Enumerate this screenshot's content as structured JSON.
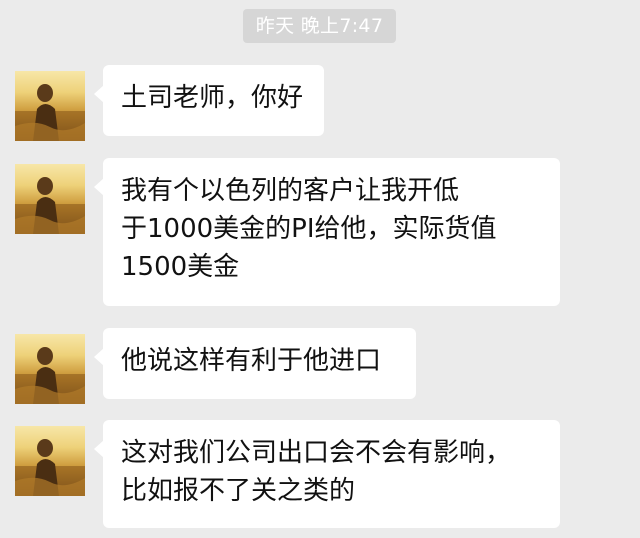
{
  "conversation": {
    "timestamp": "昨天 晚上7:47",
    "messages": [
      {
        "sender_avatar_icon": "contact-avatar-photo",
        "text": "土司老师，你好"
      },
      {
        "sender_avatar_icon": "contact-avatar-photo",
        "text": "我有个以色列的客户让我开低\n于1000美金的PI给他，实际货值\n1500美金"
      },
      {
        "sender_avatar_icon": "contact-avatar-photo",
        "text": "他说这样有利于他进口"
      },
      {
        "sender_avatar_icon": "contact-avatar-photo",
        "text": "这对我们公司出口会不会有影响，\n比如报不了关之类的"
      }
    ]
  },
  "colors": {
    "background": "#ebebeb",
    "bubble": "#ffffff",
    "timestamp_bg": "#d6d6d6",
    "timestamp_text": "#ffffff",
    "text": "#111111"
  }
}
